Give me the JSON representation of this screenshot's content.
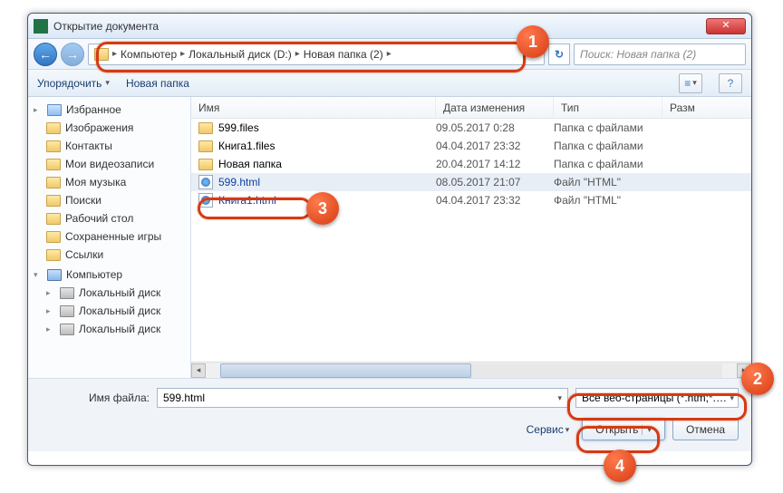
{
  "title": "Открытие документа",
  "breadcrumb": {
    "seg1": "Компьютер",
    "seg2": "Локальный диск (D:)",
    "seg3": "Новая папка (2)"
  },
  "search_placeholder": "Поиск: Новая папка (2)",
  "toolbar": {
    "organize": "Упорядочить",
    "newfolder": "Новая папка"
  },
  "columns": {
    "name": "Имя",
    "date": "Дата изменения",
    "type": "Тип",
    "size": "Разм"
  },
  "sidebar": {
    "favorites": "Избранное",
    "items": [
      "Изображения",
      "Контакты",
      "Мои видеозаписи",
      "Моя музыка",
      "Поиски",
      "Рабочий стол",
      "Сохраненные игры",
      "Ссылки"
    ],
    "computer": "Компьютер",
    "drives": [
      "Локальный диск",
      "Локальный диск",
      "Локальный диск"
    ]
  },
  "files": [
    {
      "name": "599.files",
      "date": "09.05.2017 0:28",
      "type": "Папка с файлами",
      "kind": "folder"
    },
    {
      "name": "Книга1.files",
      "date": "04.04.2017 23:32",
      "type": "Папка с файлами",
      "kind": "folder"
    },
    {
      "name": "Новая папка",
      "date": "20.04.2017 14:12",
      "type": "Папка с файлами",
      "kind": "folder"
    },
    {
      "name": "599.html",
      "date": "08.05.2017 21:07",
      "type": "Файл \"HTML\"",
      "kind": "html",
      "selected": true
    },
    {
      "name": "Книга1.html",
      "date": "04.04.2017 23:32",
      "type": "Файл \"HTML\"",
      "kind": "html"
    }
  ],
  "filename": {
    "label": "Имя файла:",
    "value": "599.html"
  },
  "filetype": "Все веб-страницы (*.htm;*.html)",
  "service": "Сервис",
  "open": "Открыть",
  "cancel": "Отмена",
  "callouts": {
    "c1": "1",
    "c2": "2",
    "c3": "3",
    "c4": "4"
  }
}
